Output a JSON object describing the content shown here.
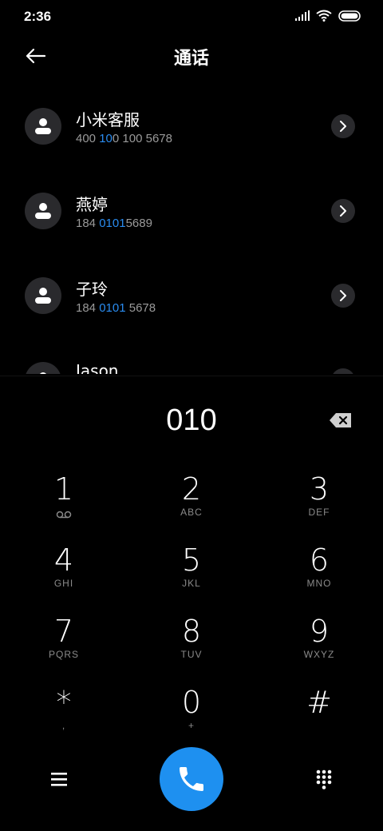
{
  "status": {
    "time": "2:36"
  },
  "header": {
    "title": "通话"
  },
  "contacts": [
    {
      "name": "小米客服",
      "num_parts": [
        "400",
        " 10",
        "0 10",
        "0 5678"
      ]
    },
    {
      "name": "燕婷",
      "num_parts": [
        "184 ",
        "0101",
        "",
        "5689"
      ]
    },
    {
      "name": "子玲",
      "num_parts": [
        "184 ",
        "0101",
        "",
        " 5678"
      ]
    },
    {
      "name": "Jason",
      "num_parts": [
        "",
        "",
        "",
        ""
      ]
    }
  ],
  "dialed": "010",
  "keys": [
    {
      "digit": "1",
      "letters": ""
    },
    {
      "digit": "2",
      "letters": "ABC"
    },
    {
      "digit": "3",
      "letters": "DEF"
    },
    {
      "digit": "4",
      "letters": "GHI"
    },
    {
      "digit": "5",
      "letters": "JKL"
    },
    {
      "digit": "6",
      "letters": "MNO"
    },
    {
      "digit": "7",
      "letters": "PQRS"
    },
    {
      "digit": "8",
      "letters": "TUV"
    },
    {
      "digit": "9",
      "letters": "WXYZ"
    },
    {
      "digit": "*",
      "letters": ","
    },
    {
      "digit": "0",
      "letters": "+"
    },
    {
      "digit": "#",
      "letters": ""
    }
  ],
  "colors": {
    "accent": "#1e90f0",
    "highlight": "#2a8cf0",
    "chip": "#2a2a2d"
  },
  "icons": {
    "back": "arrow-left-icon",
    "voicemail": "voicemail-icon",
    "backspace": "backspace-icon",
    "call": "phone-icon",
    "menu": "menu-icon",
    "dialpad": "dialpad-icon"
  }
}
